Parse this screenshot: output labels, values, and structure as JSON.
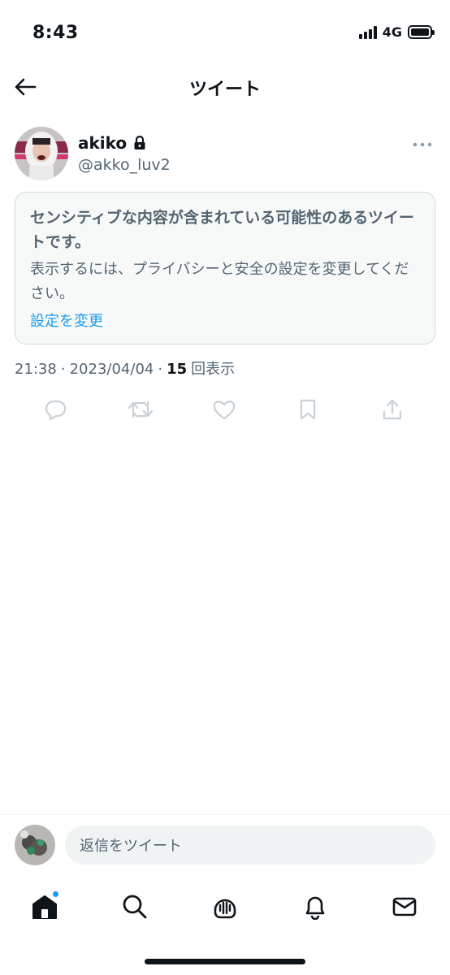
{
  "status_bar": {
    "time": "8:43",
    "network": "4G"
  },
  "header": {
    "title": "ツイート",
    "back_icon": "arrow-left-icon"
  },
  "tweet": {
    "author_name": "akiko",
    "author_handle": "@akko_luv2",
    "protected_icon": "lock-icon",
    "more_icon": "more-horizontal-icon",
    "sensitive_notice": {
      "title": "センシティブな内容が含まれている可能性のあるツイートです。",
      "description": "表示するには、プライバシーと安全の設定を変更してください。",
      "link_label": "設定を変更"
    },
    "time": "21:38",
    "separator": "·",
    "date": "2023/04/04",
    "views_count": "15",
    "views_label": "回表示"
  },
  "actions": [
    "reply-icon",
    "retweet-icon",
    "like-icon",
    "bookmark-icon",
    "share-icon"
  ],
  "reply_bar": {
    "placeholder": "返信をツイート"
  },
  "bottom_nav": [
    "home-icon",
    "search-icon",
    "spaces-icon",
    "notifications-icon",
    "messages-icon"
  ],
  "colors": {
    "accent": "#1d9bf0",
    "secondary_text": "#536471",
    "primary_text": "#0f1419"
  }
}
